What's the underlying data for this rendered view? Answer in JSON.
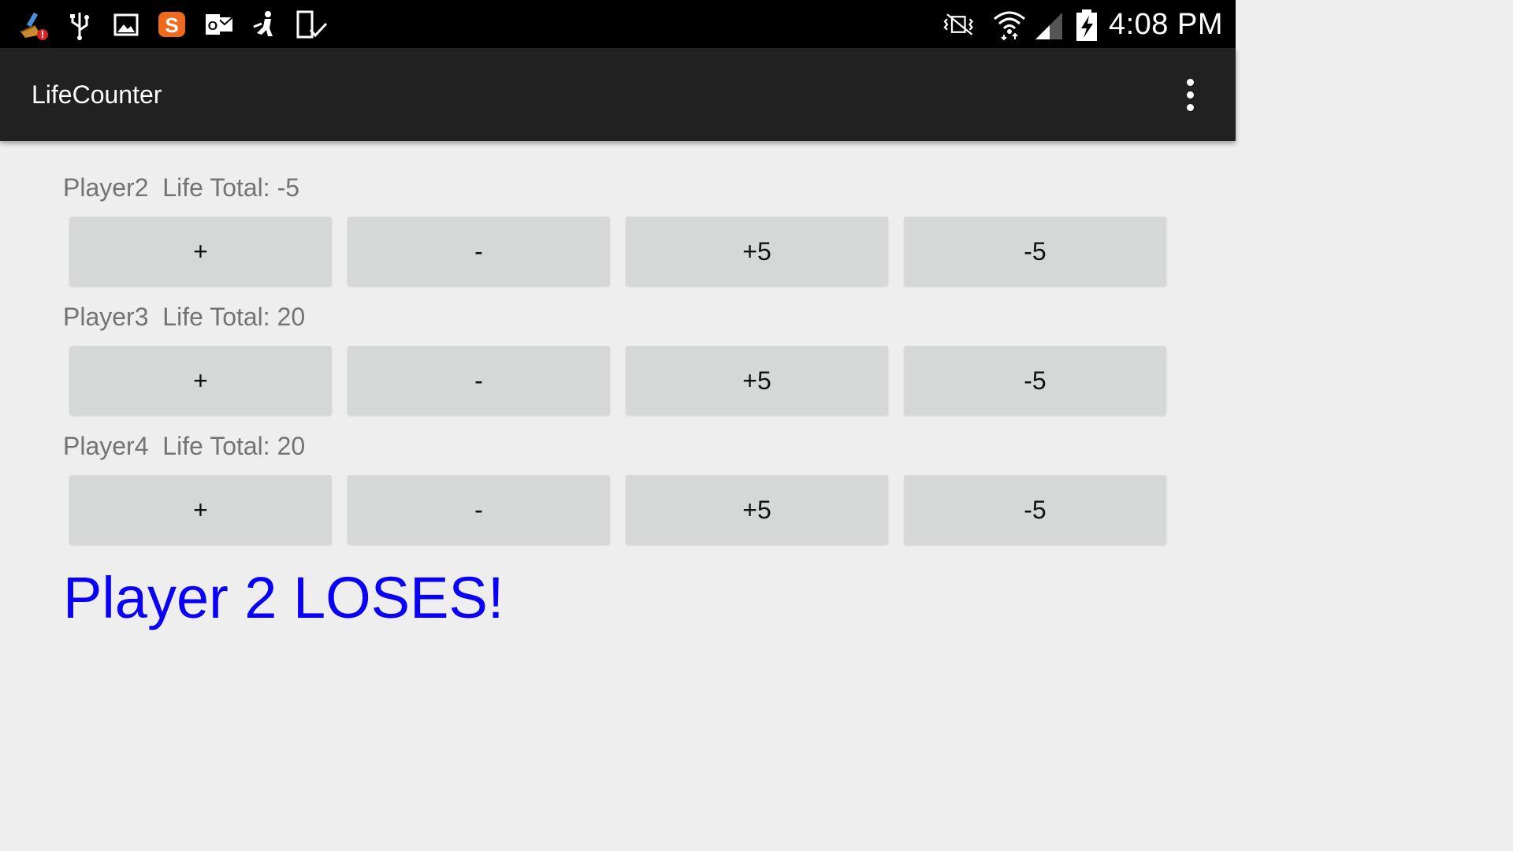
{
  "status_bar": {
    "icons_left": [
      "cleaner-icon",
      "usb-icon",
      "gallery-icon",
      "sogou-icon",
      "outlook-icon",
      "download-icon",
      "device-check-icon"
    ],
    "icons_right": [
      "vibrate-mute-icon",
      "wifi-icon",
      "signal-icon",
      "battery-charging-icon"
    ],
    "time": "4:08 PM"
  },
  "action_bar": {
    "title": "LifeCounter",
    "overflow_icon": "more-vert-icon"
  },
  "players": [
    {
      "name": "Player2",
      "life_label": "Life Total:",
      "life_total": "-5",
      "display": "Player2  Life Total: -5",
      "buttons": [
        "+",
        "-",
        "+5",
        "-5"
      ]
    },
    {
      "name": "Player3",
      "life_label": "Life Total:",
      "life_total": "20",
      "display": "Player3  Life Total: 20",
      "buttons": [
        "+",
        "-",
        "+5",
        "-5"
      ]
    },
    {
      "name": "Player4",
      "life_label": "Life Total:",
      "life_total": "20",
      "display": "Player4  Life Total: 20",
      "buttons": [
        "+",
        "-",
        "+5",
        "-5"
      ]
    }
  ],
  "status_message": "Player 2 LOSES!",
  "colors": {
    "status_bar_bg": "#000000",
    "action_bar_bg": "#212121",
    "content_bg": "#eeeeee",
    "button_bg": "#d6d7d7",
    "label_text": "#737373",
    "loses_text": "#0a00f5"
  }
}
